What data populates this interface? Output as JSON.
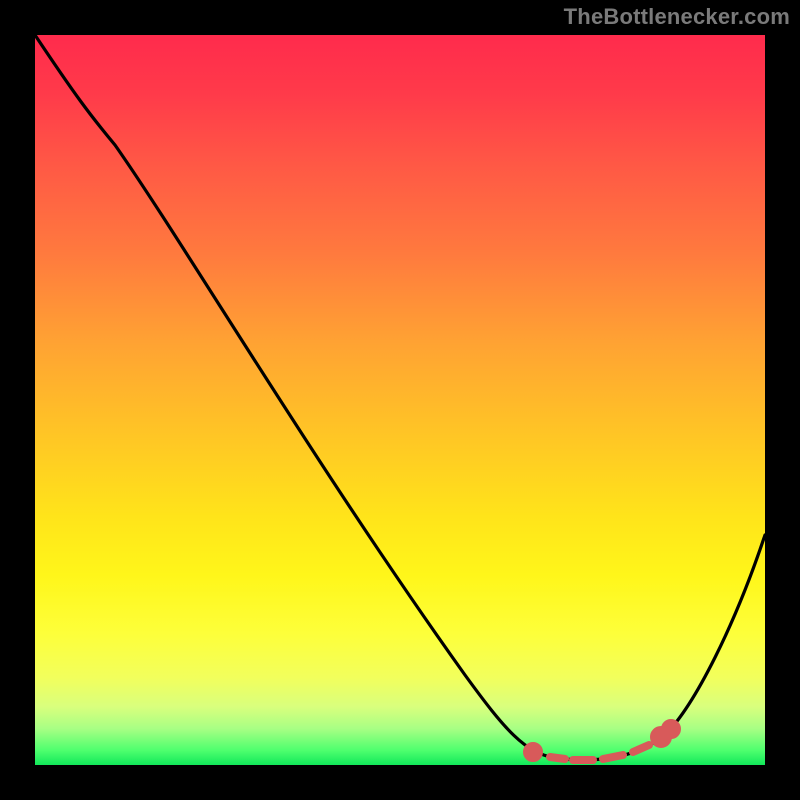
{
  "attribution": "TheBottlenecker.com",
  "chart_data": {
    "type": "line",
    "title": "",
    "xlabel": "",
    "ylabel": "",
    "xlim": [
      0,
      100
    ],
    "ylim": [
      0,
      100
    ],
    "x": [
      0,
      6,
      12,
      20,
      28,
      36,
      44,
      52,
      60,
      66,
      70,
      74,
      78,
      82,
      86,
      90,
      94,
      98,
      100
    ],
    "values": [
      100,
      93,
      86,
      76,
      65,
      54,
      43,
      32,
      21,
      12,
      6,
      2,
      1,
      1,
      2,
      7,
      15,
      26,
      32
    ],
    "optimal_band": {
      "x_start": 70,
      "x_end": 88,
      "values_in_band": [
        6,
        2,
        1,
        1,
        2,
        4
      ]
    },
    "colors": {
      "curve": "#000000",
      "marker": "#d85a5a",
      "gradient_top": "#ff2b4c",
      "gradient_bottom": "#12e85a",
      "background": "#000000"
    }
  }
}
